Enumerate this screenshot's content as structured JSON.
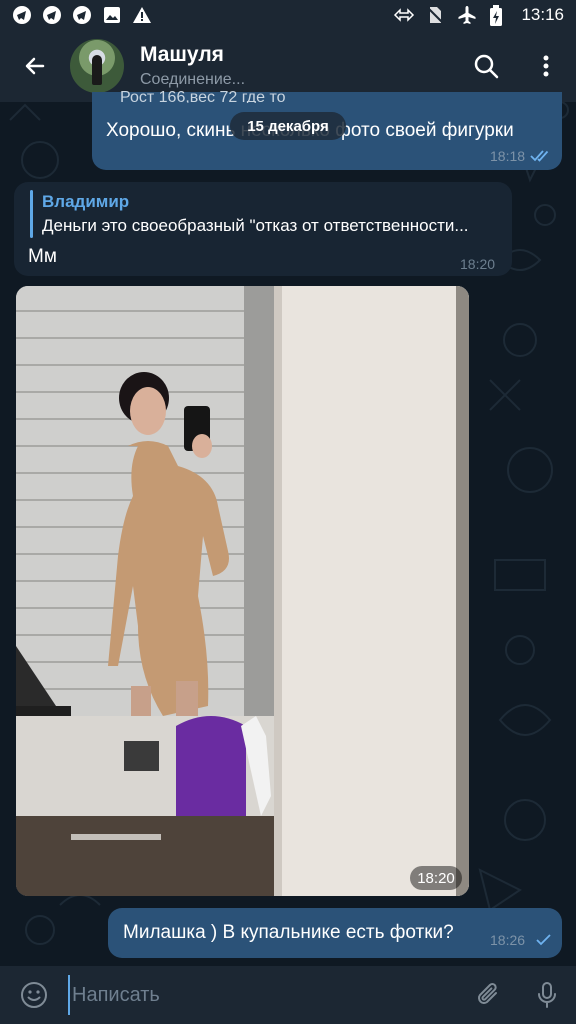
{
  "status_bar": {
    "time": "13:16",
    "icons": [
      "telegram-icon",
      "telegram-icon",
      "telegram-icon",
      "image-icon",
      "warning-icon",
      "data-arrows-icon",
      "no-sim-icon",
      "airplane-icon",
      "battery-icon"
    ]
  },
  "header": {
    "title": "Машуля",
    "status": "Соединение...",
    "back_icon": "arrow-left-icon",
    "search_icon": "search-icon",
    "menu_icon": "more-vert-icon"
  },
  "messages": {
    "partial_top_text": "Рост 166,вес 72 где то",
    "out1_text": "Хорошо, скинь несколько фото своей фигурки",
    "out1_time": "18:18",
    "date_pill": "15 декабря",
    "in1_reply_name": "Владимир",
    "in1_reply_text": "Деньги это своеобразный \"отказ от ответственности...",
    "in1_text": "Мм",
    "in1_time": "18:20",
    "photo_time": "18:20",
    "out2_text": "Милашка ) В купальнике есть фотки?",
    "out2_time": "18:26"
  },
  "input": {
    "placeholder": "Написать",
    "emoji_icon": "emoji-icon",
    "attach_icon": "paperclip-icon",
    "mic_icon": "microphone-icon"
  },
  "colors": {
    "header_bg": "#1c2733",
    "chat_bg": "#0e1621",
    "outgoing_bubble": "#2b5278",
    "incoming_bubble": "#182533",
    "accent": "#5fa8e7"
  }
}
